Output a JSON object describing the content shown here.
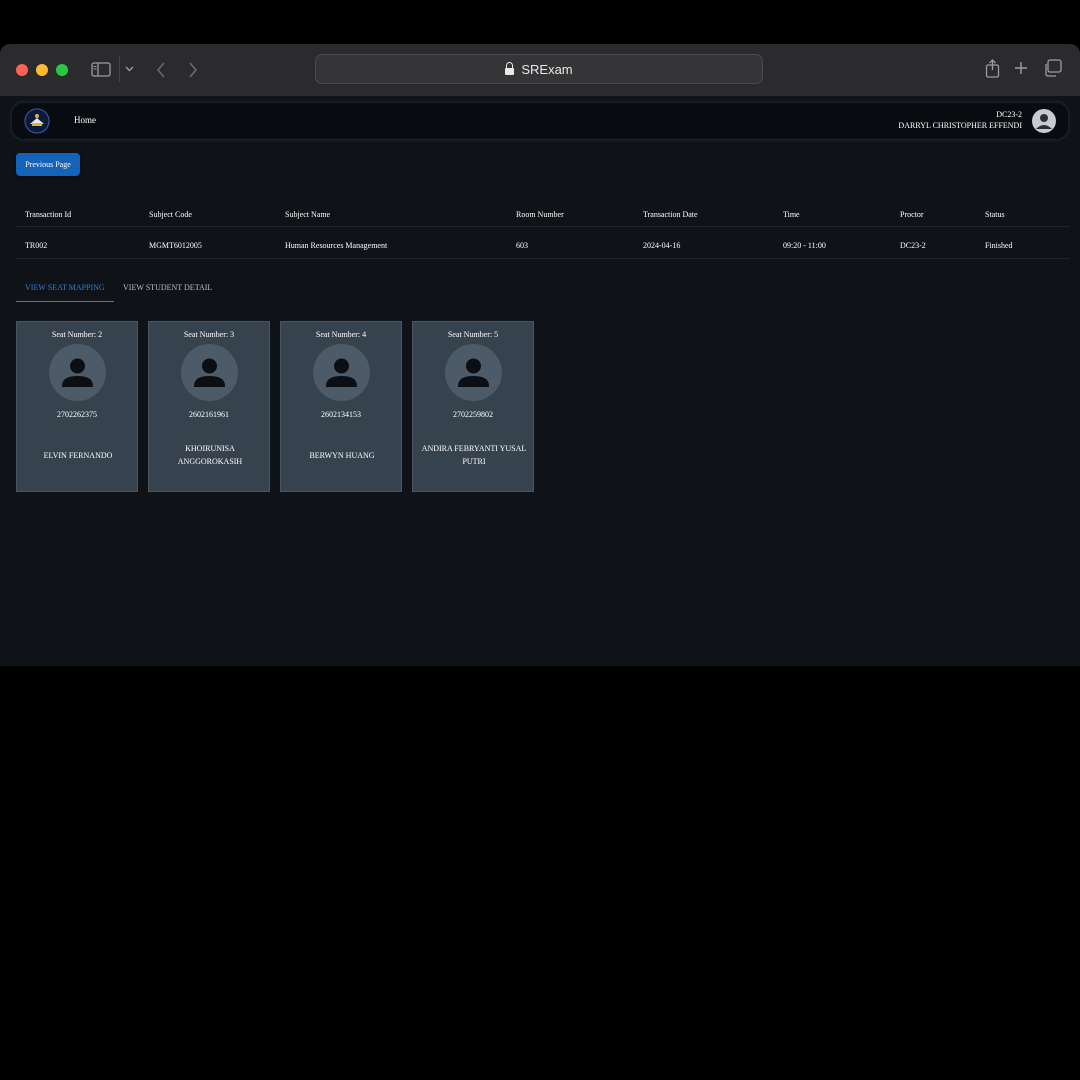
{
  "browser": {
    "url_text": "SRExam",
    "traffic_lights": {
      "close": "#ff5f57",
      "minimize": "#febc2e",
      "maximize": "#28c840"
    },
    "icons": [
      "sidebar-icon",
      "chevron-down-icon",
      "back-arrow-icon",
      "forward-arrow-icon",
      "lock-icon",
      "share-icon",
      "new-tab-icon",
      "tab-overview-icon"
    ]
  },
  "navbar": {
    "home_label": "Home",
    "user_code": "DC23-2",
    "user_name": "DARRYL CHRISTOPHER EFFENDI"
  },
  "previous_button": "Previous Page",
  "transaction_table": {
    "headers": [
      "Transaction Id",
      "Subject Code",
      "Subject Name",
      "Room Number",
      "Transaction Date",
      "Time",
      "Proctor",
      "Status"
    ],
    "rows": [
      [
        "TR002",
        "MGMT6012005",
        "Human Resources Management",
        "603",
        "2024-04-16",
        "09:20 - 11:00",
        "DC23-2",
        "Finished"
      ]
    ]
  },
  "tabs": [
    {
      "label": "VIEW SEAT MAPPING",
      "active": true
    },
    {
      "label": "VIEW STUDENT DETAIL",
      "active": false
    }
  ],
  "seats": [
    {
      "seat_label": "Seat Number: 2",
      "student_id": "2702262375",
      "student_name": "ELVIN FERNANDO"
    },
    {
      "seat_label": "Seat Number: 3",
      "student_id": "2602161961",
      "student_name": "KHOIRUNISA ANGGOROKASIH"
    },
    {
      "seat_label": "Seat Number: 4",
      "student_id": "2602134153",
      "student_name": "BERWYN HUANG"
    },
    {
      "seat_label": "Seat Number: 5",
      "student_id": "2702259802",
      "student_name": "ANDIRA FEBRYANTI YUSAL PUTRI"
    }
  ],
  "colors": {
    "accent": "#1463b8",
    "tab_active": "#2d7fd8",
    "card": "#36424e",
    "background": "#0f1318"
  }
}
